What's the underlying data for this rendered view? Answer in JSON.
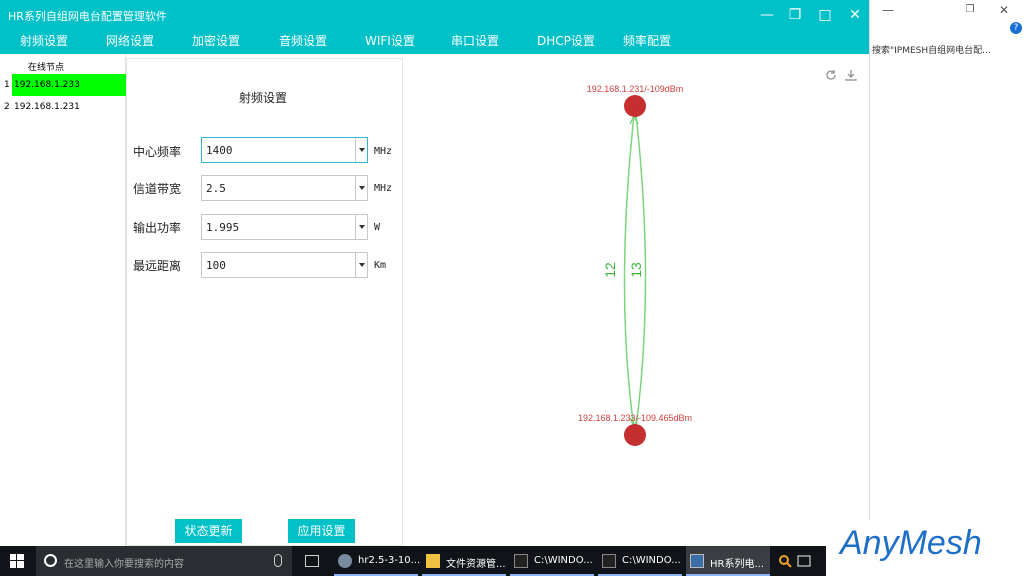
{
  "window": {
    "title": "HR系列自组网电台配置管理软件"
  },
  "menu": [
    {
      "label": "射频设置"
    },
    {
      "label": "网络设置"
    },
    {
      "label": "加密设置"
    },
    {
      "label": "音频设置"
    },
    {
      "label": "WIFI设置"
    },
    {
      "label": "串口设置"
    },
    {
      "label": "DHCP设置"
    },
    {
      "label": "频率配置"
    }
  ],
  "nodes": {
    "header": "在线节点",
    "items": [
      {
        "index": "1",
        "ip": "192.168.1.233",
        "selected": true
      },
      {
        "index": "2",
        "ip": "192.168.1.231",
        "selected": false
      }
    ]
  },
  "settings": {
    "title": "射频设置",
    "fields": [
      {
        "label": "中心频率",
        "value": "1400",
        "unit": "MHz"
      },
      {
        "label": "信道带宽",
        "value": "2.5",
        "unit": "MHz"
      },
      {
        "label": "输出功率",
        "value": "1.995",
        "unit": "W"
      },
      {
        "label": "最远距离",
        "value": "100",
        "unit": "Km"
      }
    ],
    "status_btn": "状态更新",
    "apply_btn": "应用设置"
  },
  "topology": {
    "node_top_label": "192.168.1.231/-109dBm",
    "node_bottom_label": "192.168.1.233/-109.465dBm",
    "link_left_label": "12",
    "link_right_label": "13",
    "node_color": "#c62f2f",
    "link_color": "#7ed37e"
  },
  "bg_window": {
    "search_text": "搜索\"IPMESH自组网电台配..."
  },
  "taskbar": {
    "search_placeholder": "在这里输入你要搜索的内容",
    "items": [
      {
        "label": "hr2.5-3-10..."
      },
      {
        "label": "文件资源管..."
      },
      {
        "label": "C:\\WINDO..."
      },
      {
        "label": "C:\\WINDO..."
      },
      {
        "label": "HR系列电..."
      }
    ]
  },
  "logo": {
    "text": "AnyMesh"
  }
}
